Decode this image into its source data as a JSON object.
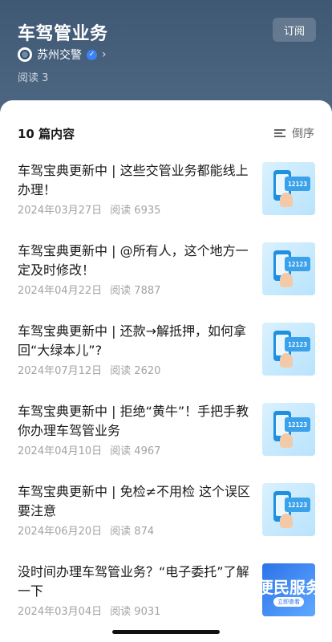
{
  "header": {
    "title": "车驾管业务",
    "subscribe_label": "订阅",
    "account_name": "苏州交警",
    "chevron": "›",
    "verified_icon": "verified-badge-icon",
    "reads": "阅读 3"
  },
  "list": {
    "count_label": "10 篇内容",
    "sort_label": "倒序",
    "sort_icon": "sort-lines-icon",
    "items": [
      {
        "title": "车驾宝典更新中 | 这些交管业务都能线上办理！",
        "date": "2024年03月27日",
        "reads": "阅读 6935",
        "thumb_tag": "12123"
      },
      {
        "title": "车驾宝典更新中 | @所有人，这个地方一定及时修改！",
        "date": "2024年04月22日",
        "reads": "阅读 7887",
        "thumb_tag": "12123"
      },
      {
        "title": "车驾宝典更新中 | 还款→解抵押，如何拿回“大绿本儿”?",
        "date": "2024年07月12日",
        "reads": "阅读 2620",
        "thumb_tag": "12123"
      },
      {
        "title": "车驾宝典更新中 | 拒绝“黄牛”！手把手教你办理车驾管业务",
        "date": "2024年04月10日",
        "reads": "阅读 4967",
        "thumb_tag": "12123"
      },
      {
        "title": "车驾宝典更新中 | 免检≠不用检 这个误区要注意",
        "date": "2024年06月20日",
        "reads": "阅读 874",
        "thumb_tag": "12123"
      },
      {
        "title": "没时间办理车驾管业务？“电子委托”了解一下",
        "date": "2024年03月04日",
        "reads": "阅读 9031",
        "thumb_banner": "便民服务",
        "thumb_button": "立即查看"
      }
    ]
  }
}
